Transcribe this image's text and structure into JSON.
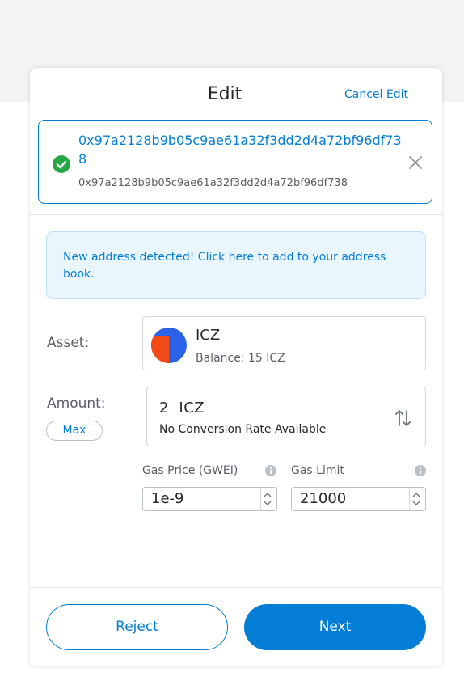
{
  "header": {
    "title": "Edit",
    "cancel_label": "Cancel Edit"
  },
  "recipient": {
    "address_line1": "0x97a2128b9b05c9ae61a32f3dd2d4a72bf96df73",
    "address_line2": "8",
    "address_sub": "0x97a2128b9b05c9ae61a32f3dd2d4a72bf96df738"
  },
  "notice": {
    "text": "New address detected! Click here to add to your address book."
  },
  "asset": {
    "label": "Asset:",
    "name": "ICZ",
    "balance": "Balance: 15 ICZ"
  },
  "amount": {
    "label": "Amount:",
    "max_label": "Max",
    "value": "2  ICZ",
    "conversion": "No Conversion Rate Available"
  },
  "gas": {
    "price_label": "Gas Price (GWEI)",
    "price_value": "1e-9",
    "limit_label": "Gas Limit",
    "limit_value": "21000"
  },
  "footer": {
    "reject_label": "Reject",
    "next_label": "Next"
  },
  "colors": {
    "accent": "#037dd6",
    "success": "#28a745",
    "token_red": "#f24a17",
    "token_blue": "#2a62e8"
  },
  "icons": [
    "check-circle-icon",
    "close-icon",
    "token-icon",
    "swap-arrows-icon",
    "info-icon",
    "stepper-icon"
  ]
}
